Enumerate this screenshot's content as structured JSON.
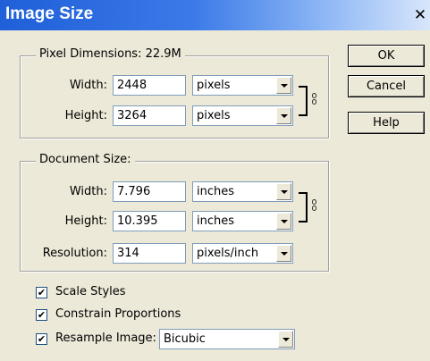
{
  "window": {
    "title": "Image Size",
    "close_glyph": "✕"
  },
  "buttons": {
    "ok": "OK",
    "cancel": "Cancel",
    "help": "Help"
  },
  "pixel_dimensions": {
    "legend": "Pixel Dimensions:  22.9M",
    "width_label": "Width:",
    "width_value": "2448",
    "width_unit": "pixels",
    "height_label": "Height:",
    "height_value": "3264",
    "height_unit": "pixels"
  },
  "document_size": {
    "legend": "Document Size:",
    "width_label": "Width:",
    "width_value": "7.796",
    "width_unit": "inches",
    "height_label": "Height:",
    "height_value": "10.395",
    "height_unit": "inches",
    "resolution_label": "Resolution:",
    "resolution_value": "314",
    "resolution_unit": "pixels/inch"
  },
  "options": {
    "scale_styles": {
      "label": "Scale Styles",
      "checked": true
    },
    "constrain_proportions": {
      "label": "Constrain Proportions",
      "checked": true
    },
    "resample_image": {
      "label": "Resample Image:",
      "checked": true,
      "method": "Bicubic"
    }
  },
  "icons": {
    "link": "chain-link-icon",
    "dropdown": "chevron-down-icon",
    "check": "checkmark-icon"
  }
}
